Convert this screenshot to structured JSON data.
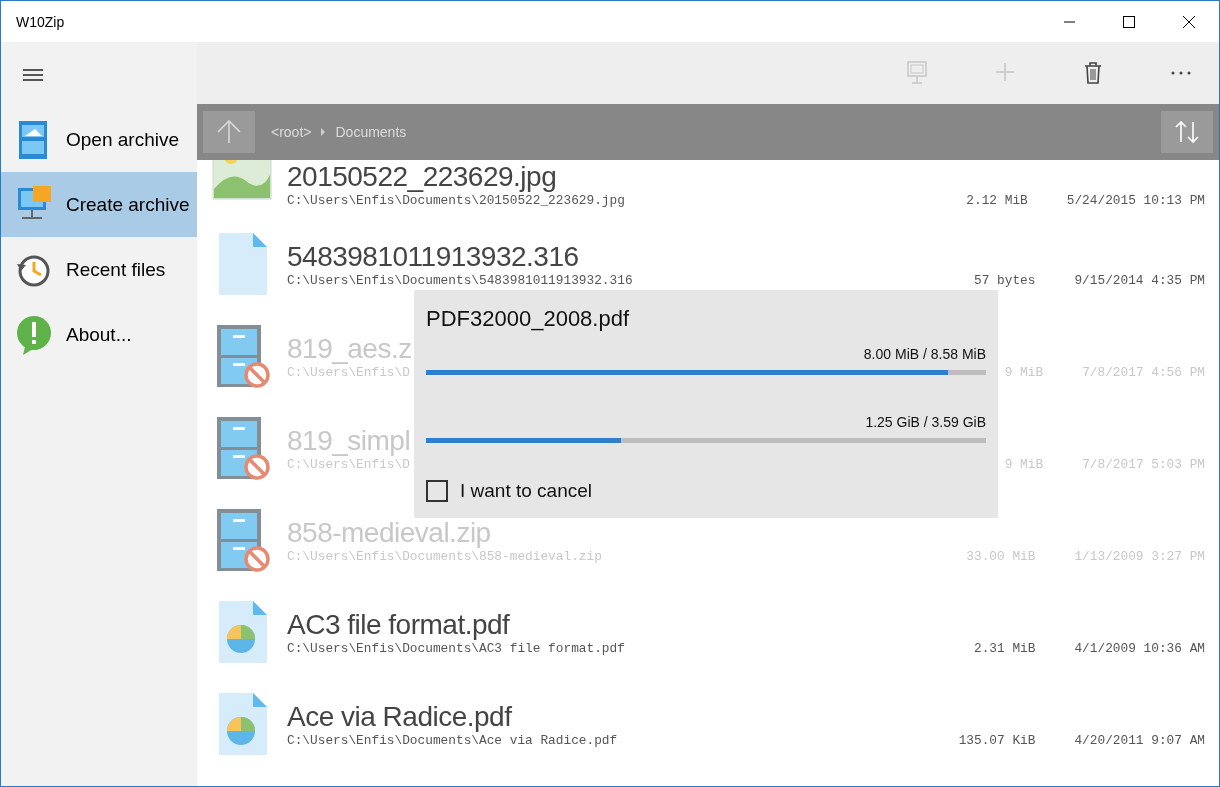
{
  "window": {
    "title": "W10Zip"
  },
  "sidebar": {
    "items": [
      {
        "kind": "open",
        "label": "Open archive",
        "selected": false
      },
      {
        "kind": "create",
        "label": "Create archive",
        "selected": true
      },
      {
        "kind": "recent",
        "label": "Recent files",
        "selected": false
      },
      {
        "kind": "about",
        "label": "About...",
        "selected": false
      }
    ]
  },
  "toolbar": {
    "buttons": [
      {
        "kind": "extract",
        "disabled": true
      },
      {
        "kind": "add",
        "disabled": true
      },
      {
        "kind": "delete",
        "disabled": false
      },
      {
        "kind": "more",
        "disabled": false
      }
    ]
  },
  "breadcrumb": {
    "items": [
      "<root>",
      "Documents"
    ]
  },
  "files": [
    {
      "kind": "image",
      "name": "20150522_223629.jpg",
      "path": "C:\\Users\\Enfis\\Documents\\20150522_223629.jpg",
      "size": "2.12 MiB",
      "date": "5/24/2015 10:13 PM",
      "disabled": false
    },
    {
      "kind": "file",
      "name": "5483981011913932.316",
      "path": "C:\\Users\\Enfis\\Documents\\5483981011913932.316",
      "size": "57 bytes",
      "date": "9/15/2014 4:35 PM",
      "disabled": false
    },
    {
      "kind": "archive",
      "name": "819_aes.z",
      "path": "C:\\Users\\Enfis\\D",
      "size": "9 MiB",
      "date": "7/8/2017 4:56 PM",
      "disabled": true
    },
    {
      "kind": "archive",
      "name": "819_simpl",
      "path": "C:\\Users\\Enfis\\D",
      "size": "9 MiB",
      "date": "7/8/2017 5:03 PM",
      "disabled": true
    },
    {
      "kind": "archive",
      "name": "858-medieval.zip",
      "path": "C:\\Users\\Enfis\\Documents\\858-medieval.zip",
      "size": "33.00 MiB",
      "date": "1/13/2009 3:27 PM",
      "disabled": true
    },
    {
      "kind": "pdf",
      "name": "AC3 file format.pdf",
      "path": "C:\\Users\\Enfis\\Documents\\AC3 file format.pdf",
      "size": "2.31 MiB",
      "date": "4/1/2009 10:36 AM",
      "disabled": false
    },
    {
      "kind": "pdf",
      "name": "Ace via Radice.pdf",
      "path": "C:\\Users\\Enfis\\Documents\\Ace via Radice.pdf",
      "size": "135.07 KiB",
      "date": "4/20/2011 9:07 AM",
      "disabled": false
    }
  ],
  "progress_dialog": {
    "title": "PDF32000_2008.pdf",
    "bars": [
      {
        "reading": "8.00 MiB / 8.58 MiB",
        "level": 0.932
      },
      {
        "reading": "1.25 GiB / 3.59 GiB",
        "level": 0.348
      }
    ],
    "checkbox": {
      "label": "I want to cancel",
      "checked": false
    }
  }
}
